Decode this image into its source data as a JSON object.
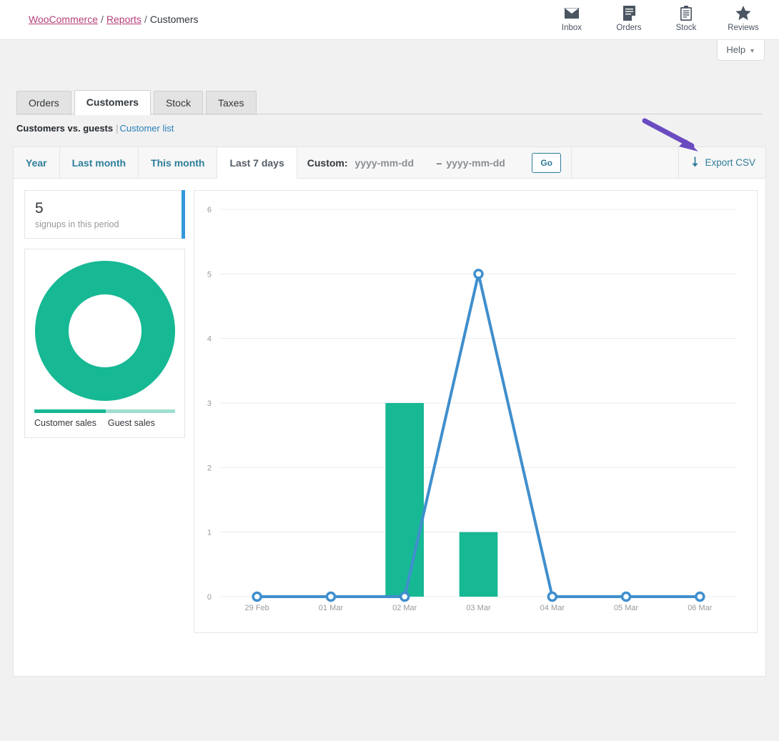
{
  "breadcrumb": {
    "root": "WooCommerce",
    "section": "Reports",
    "current": "Customers",
    "separator": "/"
  },
  "top_icons": [
    {
      "name": "inbox-icon",
      "label": "Inbox"
    },
    {
      "name": "orders-icon",
      "label": "Orders"
    },
    {
      "name": "stock-icon",
      "label": "Stock"
    },
    {
      "name": "reviews-icon",
      "label": "Reviews"
    }
  ],
  "help": {
    "label": "Help",
    "caret": "▼"
  },
  "tabs": [
    {
      "label": "Orders",
      "active": false
    },
    {
      "label": "Customers",
      "active": true
    },
    {
      "label": "Stock",
      "active": false
    },
    {
      "label": "Taxes",
      "active": false
    }
  ],
  "subnav": {
    "current": "Customers vs. guests",
    "divider": "|",
    "link": "Customer list"
  },
  "filter": {
    "ranges": [
      {
        "label": "Year",
        "active": false
      },
      {
        "label": "Last month",
        "active": false
      },
      {
        "label": "This month",
        "active": false
      },
      {
        "label": "Last 7 days",
        "active": true
      }
    ],
    "custom_label": "Custom:",
    "date_from_value": "",
    "date_from_placeholder": "yyyy-mm-dd",
    "date_separator": "–",
    "date_to_value": "",
    "date_to_placeholder": "yyyy-mm-dd",
    "go_label": "Go",
    "export_label": "Export CSV",
    "export_icon": "download-arrow-icon"
  },
  "stat": {
    "value": "5",
    "label": "signups in this period",
    "accent_color": "#3498db"
  },
  "pie": {
    "legend": [
      {
        "label": "Customer sales",
        "color": "#17b894",
        "percent": 100
      },
      {
        "label": "Guest sales",
        "color": "#9fdfd0",
        "percent": 0
      }
    ]
  },
  "chart_data": {
    "type": "bar",
    "title": "",
    "xlabel": "",
    "ylabel": "",
    "categories": [
      "29 Feb",
      "01 Mar",
      "02 Mar",
      "03 Mar",
      "04 Mar",
      "05 Mar",
      "06 Mar"
    ],
    "ylim": [
      0,
      6
    ],
    "yticks": [
      0,
      1,
      2,
      3,
      4,
      5,
      6
    ],
    "grid": true,
    "legend_position": "none",
    "series": [
      {
        "name": "Customer sales",
        "type": "bar",
        "color": "#17b894",
        "values": [
          0,
          0,
          3,
          1,
          0,
          0,
          0
        ]
      },
      {
        "name": "Signups",
        "type": "line",
        "color": "#3f8fce",
        "values": [
          0,
          0,
          0,
          5,
          0,
          0,
          0
        ]
      }
    ]
  },
  "annotation": {
    "name": "pointer-arrow",
    "color": "#6b4bc0",
    "points_at": "Export CSV"
  }
}
